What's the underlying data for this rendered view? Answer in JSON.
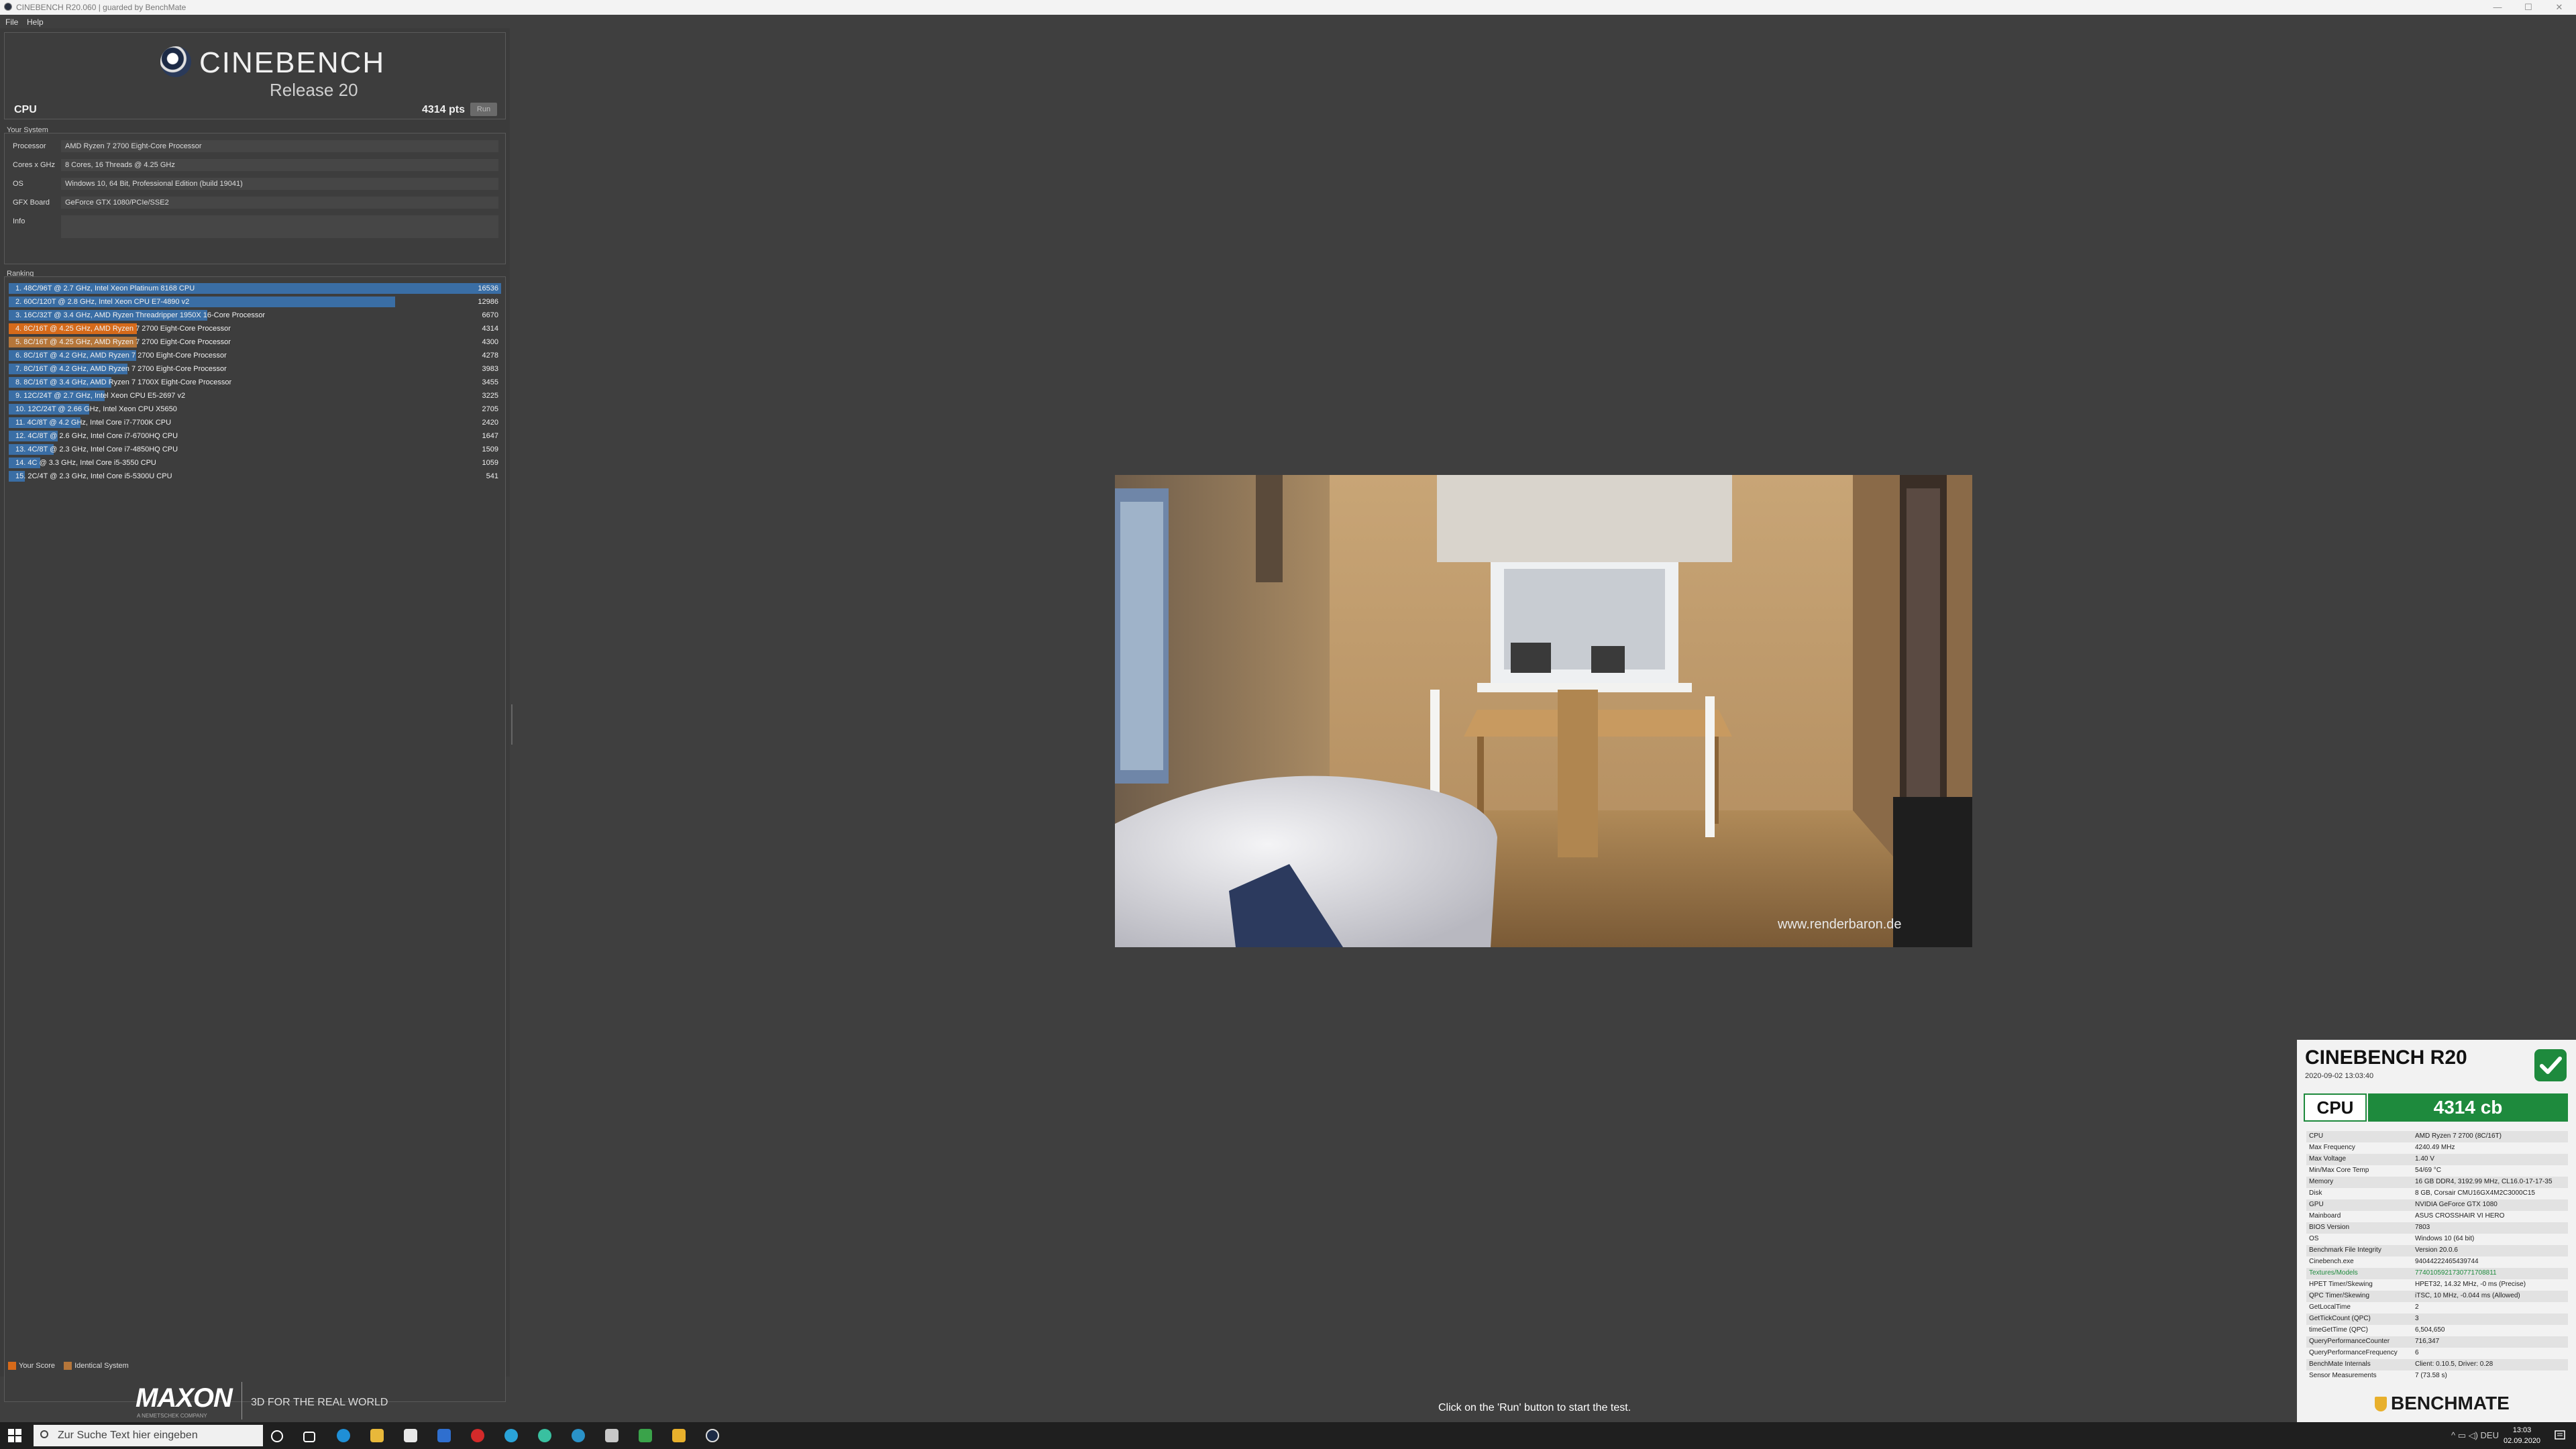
{
  "window": {
    "title": "CINEBENCH R20.060 | guarded by BenchMate",
    "minimize_glyph": "—",
    "maximize_glyph": "☐",
    "close_glyph": "✕"
  },
  "menu": {
    "file": "File",
    "help": "Help"
  },
  "header": {
    "logo_name": "CINEBENCH",
    "logo_release": "Release 20",
    "test_label": "CPU",
    "score": "4314 pts",
    "run_label": "Run"
  },
  "your_system": {
    "title": "Your System",
    "rows": [
      {
        "label": "Processor",
        "value": "AMD Ryzen 7 2700 Eight-Core Processor"
      },
      {
        "label": "Cores x GHz",
        "value": "8 Cores, 16 Threads @ 4.25 GHz"
      },
      {
        "label": "OS",
        "value": "Windows 10, 64 Bit, Professional Edition (build 19041)"
      },
      {
        "label": "GFX Board",
        "value": "GeForce GTX 1080/PCIe/SSE2"
      },
      {
        "label": "Info",
        "value": ""
      }
    ]
  },
  "ranking": {
    "title": "Ranking",
    "max_score": 16536,
    "rows": [
      {
        "label": "1. 48C/96T @ 2.7 GHz, Intel Xeon Platinum 8168 CPU",
        "score": "16536",
        "value": 16536,
        "kind": "ref"
      },
      {
        "label": "2. 60C/120T @ 2.8 GHz, Intel Xeon CPU E7-4890 v2",
        "score": "12986",
        "value": 12986,
        "kind": "ref"
      },
      {
        "label": "3. 16C/32T @ 3.4 GHz, AMD Ryzen Threadripper 1950X 16-Core Processor",
        "score": "6670",
        "value": 6670,
        "kind": "ref"
      },
      {
        "label": "4. 8C/16T @ 4.25 GHz, AMD Ryzen 7 2700 Eight-Core Processor",
        "score": "4314",
        "value": 4314,
        "kind": "yours"
      },
      {
        "label": "5. 8C/16T @ 4.25 GHz, AMD Ryzen 7 2700 Eight-Core Processor",
        "score": "4300",
        "value": 4300,
        "kind": "identical"
      },
      {
        "label": "6. 8C/16T @ 4.2 GHz, AMD Ryzen 7 2700 Eight-Core Processor",
        "score": "4278",
        "value": 4278,
        "kind": "ref"
      },
      {
        "label": "7. 8C/16T @ 4.2 GHz, AMD Ryzen 7 2700 Eight-Core Processor",
        "score": "3983",
        "value": 3983,
        "kind": "ref"
      },
      {
        "label": "8. 8C/16T @ 3.4 GHz, AMD Ryzen 7 1700X Eight-Core Processor",
        "score": "3455",
        "value": 3455,
        "kind": "ref"
      },
      {
        "label": "9. 12C/24T @ 2.7 GHz, Intel Xeon CPU E5-2697 v2",
        "score": "3225",
        "value": 3225,
        "kind": "ref"
      },
      {
        "label": "10. 12C/24T @ 2.66 GHz, Intel Xeon CPU X5650",
        "score": "2705",
        "value": 2705,
        "kind": "ref"
      },
      {
        "label": "11. 4C/8T @ 4.2 GHz, Intel Core i7-7700K CPU",
        "score": "2420",
        "value": 2420,
        "kind": "ref"
      },
      {
        "label": "12. 4C/8T @ 2.6 GHz, Intel Core i7-6700HQ CPU",
        "score": "1647",
        "value": 1647,
        "kind": "ref"
      },
      {
        "label": "13. 4C/8T @ 2.3 GHz, Intel Core i7-4850HQ CPU",
        "score": "1509",
        "value": 1509,
        "kind": "ref"
      },
      {
        "label": "14. 4C @ 3.3 GHz, Intel Core i5-3550 CPU",
        "score": "1059",
        "value": 1059,
        "kind": "ref"
      },
      {
        "label": "15. 2C/4T @ 2.3 GHz, Intel Core i5-5300U CPU",
        "score": "541",
        "value": 541,
        "kind": "ref"
      }
    ]
  },
  "legend": {
    "your_score": "Your Score",
    "identical_system": "Identical System"
  },
  "colors": {
    "bar_ref": "#3a6ea5",
    "bar_yours": "#d66a1a",
    "bar_identical": "#b5763a",
    "bm_green": "#1e8a3d"
  },
  "footer": {
    "brand": "MAXON",
    "brand_sub": "A NEMETSCHEK COMPANY",
    "tagline": "3D FOR THE REAL WORLD",
    "status": "Click on the 'Run' button to start the test."
  },
  "render": {
    "watermark": "www.renderbaron.de"
  },
  "benchmate": {
    "title": "CINEBENCH R20",
    "datetime": "2020-09-02 13:03:40",
    "cpu_label": "CPU",
    "score": "4314 cb",
    "rows": [
      {
        "k": "CPU",
        "v": "AMD Ryzen 7 2700 (8C/16T)"
      },
      {
        "k": "Max Frequency",
        "v": "4240.49 MHz"
      },
      {
        "k": "Max Voltage",
        "v": "1.40 V"
      },
      {
        "k": "Min/Max Core Temp",
        "v": "54/69 °C"
      },
      {
        "k": "Memory",
        "v": "16 GB DDR4, 3192.99 MHz, CL16.0-17-17-35"
      },
      {
        "k": "Disk",
        "v": "8 GB, Corsair CMU16GX4M2C3000C15"
      },
      {
        "k": "GPU",
        "v": "NVIDIA GeForce GTX 1080"
      },
      {
        "k": "Mainboard",
        "v": "ASUS CROSSHAIR VI HERO"
      },
      {
        "k": "BIOS Version",
        "v": "7803"
      },
      {
        "k": "OS",
        "v": "Windows 10 (64 bit)"
      },
      {
        "k": "Benchmark File Integrity",
        "v": "Version 20.0.6"
      },
      {
        "k": "Cinebench.exe",
        "v": "94044222465439744"
      },
      {
        "k": "Textures/Models",
        "v": "7740105921730771708811"
      },
      {
        "k": "HPET Timer/Skewing",
        "v": "HPET32, 14.32 MHz, -0 ms (Precise)"
      },
      {
        "k": "QPC Timer/Skewing",
        "v": "iTSC, 10 MHz, -0.044 ms (Allowed)"
      },
      {
        "k": "GetLocalTime",
        "v": "2"
      },
      {
        "k": "GetTickCount (QPC)",
        "v": "3"
      },
      {
        "k": "timeGetTime (QPC)",
        "v": "6,504,650"
      },
      {
        "k": "QueryPerformanceCounter",
        "v": "716,347"
      },
      {
        "k": "QueryPerformanceFrequency",
        "v": "6"
      },
      {
        "k": "BenchMate Internals",
        "v": "Client: 0.10.5, Driver: 0.28"
      },
      {
        "k": "Sensor Measurements",
        "v": "7 (73.58 s)"
      }
    ],
    "logo": "BENCHMATE"
  },
  "taskbar": {
    "search_placeholder": "Zur Suche Text hier eingeben",
    "time": "13:03",
    "date": "02.09.2020",
    "tray": "^ ▭ ◁) DEU"
  }
}
